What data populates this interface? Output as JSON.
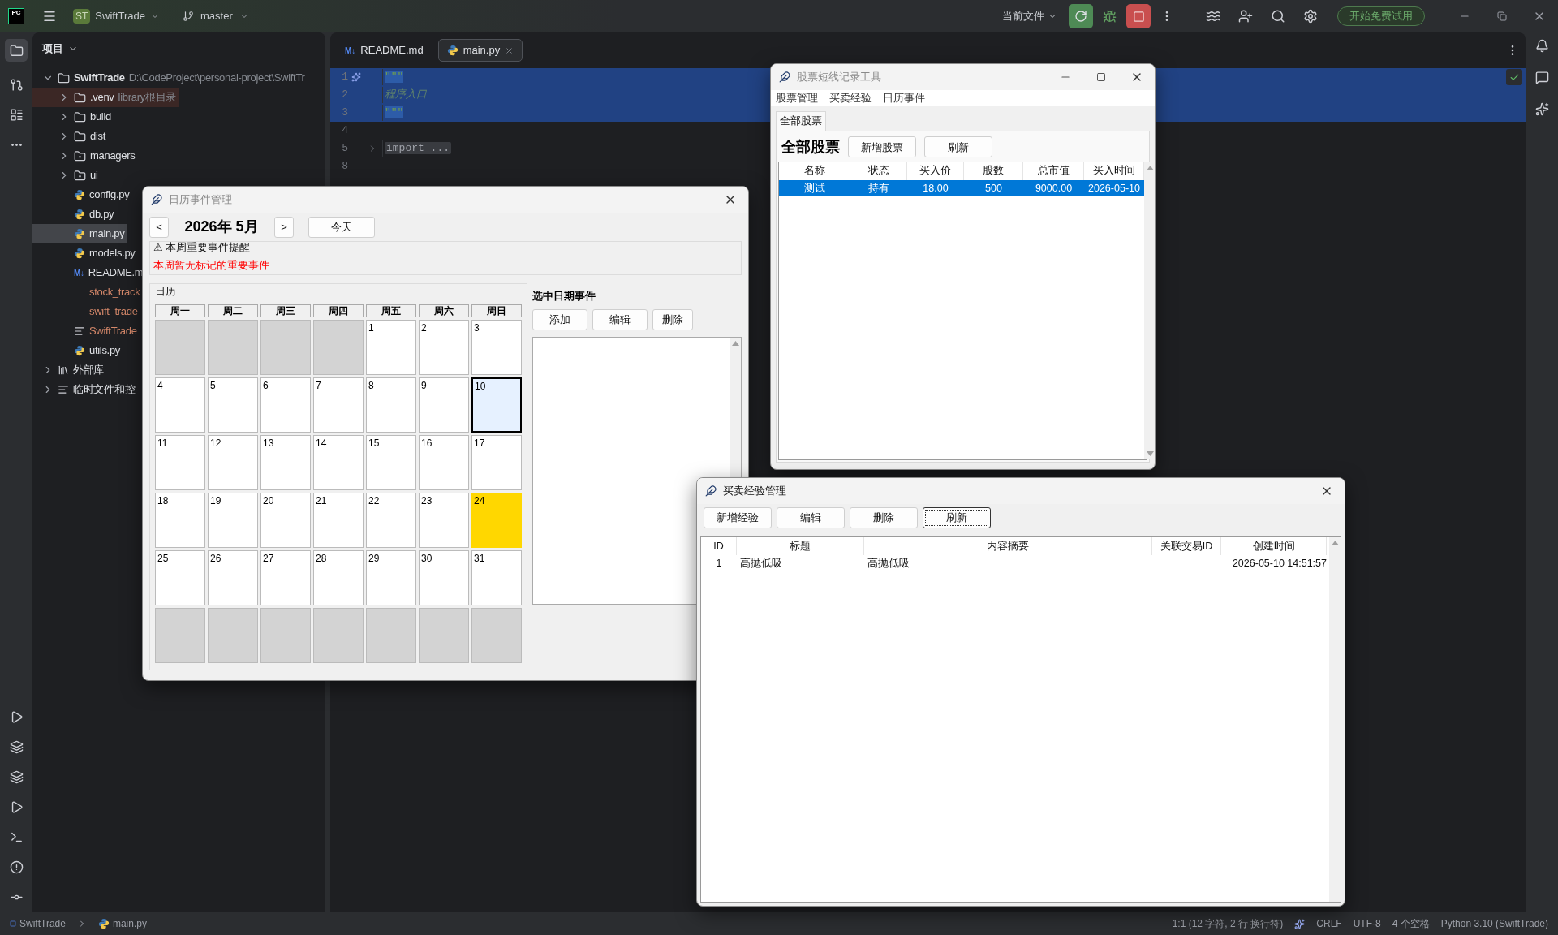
{
  "topbar": {
    "logo": "PC",
    "project_badge": "ST",
    "project": "SwiftTrade",
    "branch": "master",
    "run_config": "当前文件",
    "trial_button": "开始免费试用"
  },
  "project_panel": {
    "title": "项目",
    "tree": [
      {
        "kind": "folder",
        "label": "SwiftTrade",
        "note": "D:\\CodeProject\\personal-project\\SwiftTr",
        "expanded": true,
        "selected": false,
        "children": [
          {
            "kind": "excluded-folder",
            "label": ".venv",
            "note": "library根目录",
            "expanded": false,
            "selected": false,
            "ignored": false
          },
          {
            "kind": "folder",
            "label": "build",
            "expanded": false,
            "selected": false,
            "ignored": false
          },
          {
            "kind": "folder",
            "label": "dist",
            "expanded": false,
            "selected": false,
            "ignored": false
          },
          {
            "kind": "module-folder",
            "label": "managers",
            "expanded": false,
            "selected": false,
            "ignored": false
          },
          {
            "kind": "module-folder",
            "label": "ui",
            "expanded": false,
            "selected": false,
            "ignored": false
          },
          {
            "kind": "python",
            "label": "config.py",
            "selected": false,
            "ignored": false
          },
          {
            "kind": "python",
            "label": "db.py",
            "selected": false,
            "ignored": false
          },
          {
            "kind": "python",
            "label": "main.py",
            "selected": true,
            "ignored": false
          },
          {
            "kind": "python",
            "label": "models.py",
            "selected": false,
            "ignored": false
          },
          {
            "kind": "markdown",
            "icon_text": "M↓",
            "label": "README.m",
            "selected": false,
            "ignored": false
          },
          {
            "kind": "plain",
            "label": "stock_track",
            "selected": false,
            "ignored": true
          },
          {
            "kind": "plain",
            "label": "swift_trade",
            "selected": false,
            "ignored": true
          },
          {
            "kind": "text",
            "label": "SwiftTrade",
            "selected": false,
            "ignored": true
          },
          {
            "kind": "python",
            "label": "utils.py",
            "selected": false,
            "ignored": false
          }
        ]
      },
      {
        "kind": "library",
        "label": "外部库",
        "expanded": false,
        "selected": false
      },
      {
        "kind": "scratches",
        "label": "临时文件和控",
        "expanded": false,
        "selected": false
      }
    ]
  },
  "editor": {
    "tabs": [
      {
        "kind": "markdown",
        "icon_text": "M↓",
        "label": "README.md",
        "selected": false
      },
      {
        "kind": "python",
        "label": "main.py",
        "selected": true
      }
    ],
    "lines": [
      {
        "number": "1",
        "kind": "quote",
        "code": "\"\"\"",
        "selected": true
      },
      {
        "number": "2",
        "kind": "docstring",
        "code": "程序入口",
        "selected": true
      },
      {
        "number": "3",
        "kind": "quote",
        "code": "\"\"\"",
        "selected": true
      },
      {
        "number": "4",
        "kind": "blank",
        "selected": false
      },
      {
        "number": "5",
        "kind": "folded",
        "code": "import ...",
        "selected": false
      },
      {
        "number": "8",
        "kind": "blank",
        "selected": false
      }
    ]
  },
  "stock_window": {
    "title": "股票短线记录工具",
    "active": false,
    "menu": [
      "股票管理",
      "买卖经验",
      "日历事件"
    ],
    "tabs": [
      {
        "label": "全部股票",
        "selected": true
      }
    ],
    "heading": "全部股票",
    "buttons": [
      "新增股票",
      "刷新"
    ],
    "table": {
      "columns": [
        "名称",
        "状态",
        "买入价",
        "股数",
        "总市值",
        "买入时间"
      ],
      "rows": [
        {
          "cells": [
            "测试",
            "持有",
            "18.00",
            "500",
            "9000.00",
            "2026-05-10"
          ],
          "selected": true
        }
      ]
    }
  },
  "calendar_window": {
    "title": "日历事件管理",
    "active": false,
    "prev": "<",
    "month": "2026年 5月",
    "next": ">",
    "today_button": "今天",
    "reminder_title": "⚠ 本周重要事件提醒",
    "reminder_text": "本周暂无标记的重要事件",
    "calendar_title": "日历",
    "weekdays": [
      "周一",
      "周二",
      "周三",
      "周四",
      "周五",
      "周六",
      "周日"
    ],
    "cells": [
      {
        "kind": "blank"
      },
      {
        "kind": "blank"
      },
      {
        "kind": "blank"
      },
      {
        "kind": "blank"
      },
      {
        "kind": "day",
        "day": "1",
        "selected": false,
        "marked": false
      },
      {
        "kind": "day",
        "day": "2",
        "selected": false,
        "marked": false
      },
      {
        "kind": "day",
        "day": "3",
        "selected": false,
        "marked": false
      },
      {
        "kind": "day",
        "day": "4",
        "selected": false,
        "marked": false
      },
      {
        "kind": "day",
        "day": "5",
        "selected": false,
        "marked": false
      },
      {
        "kind": "day",
        "day": "6",
        "selected": false,
        "marked": false
      },
      {
        "kind": "day",
        "day": "7",
        "selected": false,
        "marked": false
      },
      {
        "kind": "day",
        "day": "8",
        "selected": false,
        "marked": false
      },
      {
        "kind": "day",
        "day": "9",
        "selected": false,
        "marked": false
      },
      {
        "kind": "day",
        "day": "10",
        "selected": true,
        "marked": false
      },
      {
        "kind": "day",
        "day": "11",
        "selected": false,
        "marked": false
      },
      {
        "kind": "day",
        "day": "12",
        "selected": false,
        "marked": false
      },
      {
        "kind": "day",
        "day": "13",
        "selected": false,
        "marked": false
      },
      {
        "kind": "day",
        "day": "14",
        "selected": false,
        "marked": false
      },
      {
        "kind": "day",
        "day": "15",
        "selected": false,
        "marked": false
      },
      {
        "kind": "day",
        "day": "16",
        "selected": false,
        "marked": false
      },
      {
        "kind": "day",
        "day": "17",
        "selected": false,
        "marked": false
      },
      {
        "kind": "day",
        "day": "18",
        "selected": false,
        "marked": false
      },
      {
        "kind": "day",
        "day": "19",
        "selected": false,
        "marked": false
      },
      {
        "kind": "day",
        "day": "20",
        "selected": false,
        "marked": false
      },
      {
        "kind": "day",
        "day": "21",
        "selected": false,
        "marked": false
      },
      {
        "kind": "day",
        "day": "22",
        "selected": false,
        "marked": false
      },
      {
        "kind": "day",
        "day": "23",
        "selected": false,
        "marked": false
      },
      {
        "kind": "day",
        "day": "24",
        "selected": false,
        "marked": true
      },
      {
        "kind": "day",
        "day": "25",
        "selected": false,
        "marked": false
      },
      {
        "kind": "day",
        "day": "26",
        "selected": false,
        "marked": false
      },
      {
        "kind": "day",
        "day": "27",
        "selected": false,
        "marked": false
      },
      {
        "kind": "day",
        "day": "28",
        "selected": false,
        "marked": false
      },
      {
        "kind": "day",
        "day": "29",
        "selected": false,
        "marked": false
      },
      {
        "kind": "day",
        "day": "30",
        "selected": false,
        "marked": false
      },
      {
        "kind": "day",
        "day": "31",
        "selected": false,
        "marked": false
      },
      {
        "kind": "blank"
      },
      {
        "kind": "blank"
      },
      {
        "kind": "blank"
      },
      {
        "kind": "blank"
      },
      {
        "kind": "blank"
      },
      {
        "kind": "blank"
      },
      {
        "kind": "blank"
      }
    ],
    "events_title": "选中日期事件",
    "event_buttons": [
      "添加",
      "编辑",
      "删除"
    ]
  },
  "experience_window": {
    "title": "买卖经验管理",
    "active": true,
    "buttons": [
      {
        "label": "新增经验",
        "focused": false
      },
      {
        "label": "编辑",
        "focused": false
      },
      {
        "label": "删除",
        "focused": false
      },
      {
        "label": "刷新",
        "focused": true
      }
    ],
    "table": {
      "columns": [
        "ID",
        "标题",
        "内容摘要",
        "关联交易ID",
        "创建时间"
      ],
      "rows": [
        {
          "id": "1",
          "title": "高抛低吸",
          "summary": "高抛低吸",
          "created": "2026-05-10 14:51:57"
        }
      ]
    }
  },
  "status_bar": {
    "breadcrumb": [
      "SwiftTrade",
      "main.py"
    ],
    "position": "1:1 (12 字符, 2 行 换行符)",
    "line_separator": "CRLF",
    "encoding": "UTF-8",
    "indent": "4 个空格",
    "interpreter": "Python 3.10 (SwiftTrade)"
  }
}
